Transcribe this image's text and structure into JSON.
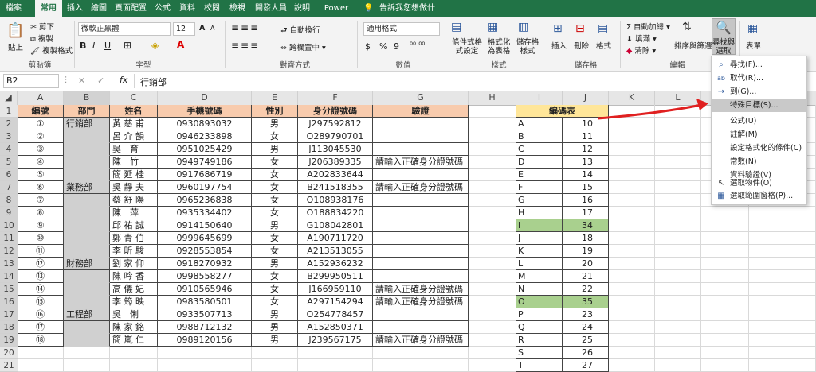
{
  "ribbon_tabs": [
    "檔案",
    "常用",
    "插入",
    "繪圖",
    "頁面配置",
    "公式",
    "資料",
    "校閱",
    "檢視",
    "開發人員",
    "說明",
    "Power Pivot",
    "告訴我您想做什麼"
  ],
  "clipboard": {
    "paste": "貼上",
    "cut": "剪下",
    "copy": "複製",
    "painter": "複製格式",
    "label": "剪貼簿"
  },
  "font": {
    "name": "微軟正黑體",
    "size": "12",
    "bold": "B",
    "italic": "I",
    "underline": "U",
    "label": "字型",
    "grow": "A",
    "shrink": "A"
  },
  "alignment": {
    "wrap": "自動換行",
    "merge": "跨欄置中",
    "label": "對齊方式"
  },
  "number": {
    "format": "通用格式",
    "label": "數值",
    "percent": "%",
    "comma": "9"
  },
  "styles": {
    "cond": "條件式格式設定",
    "table": "格式化為表格",
    "cell": "儲存格樣式",
    "label": "樣式"
  },
  "cells": {
    "insert": "插入",
    "delete": "刪除",
    "format": "格式",
    "label": "儲存格"
  },
  "editing": {
    "autosum": "自動加總",
    "fill": "填滿",
    "clear": "清除",
    "sort": "排序與篩選",
    "find": "尋找與選取",
    "label": "編輯"
  },
  "table_grp": {
    "btn": "表單"
  },
  "namebox": "B2",
  "formula": "行銷部",
  "fx": "fx",
  "columns": [
    "A",
    "B",
    "C",
    "D",
    "E",
    "F",
    "G",
    "H",
    "I",
    "J",
    "K",
    "L",
    "M"
  ],
  "row_numbers": [
    "1",
    "2",
    "3",
    "4",
    "5",
    "6",
    "7",
    "8",
    "9",
    "10",
    "11",
    "12",
    "13",
    "14",
    "15",
    "16",
    "17",
    "18",
    "19",
    "20",
    "21"
  ],
  "headers": [
    "編號",
    "部門",
    "姓名",
    "手機號碼",
    "性別",
    "身分證號碼",
    "驗證"
  ],
  "rows": [
    [
      "①",
      "行銷部",
      "黃 慈 甫",
      "0930893032",
      "男",
      "J297592812",
      ""
    ],
    [
      "②",
      "",
      "呂 介 韻",
      "0946233898",
      "女",
      "O289790701",
      ""
    ],
    [
      "③",
      "",
      "吳　育",
      "0951025429",
      "男",
      "J113045530",
      ""
    ],
    [
      "④",
      "",
      "陳　竹",
      "0949749186",
      "女",
      "J206389335",
      "請輸入正確身分證號碼"
    ],
    [
      "⑤",
      "",
      "簡 延 桂",
      "0917686719",
      "女",
      "A202833644",
      ""
    ],
    [
      "⑥",
      "業務部",
      "吳 靜 夫",
      "0960197754",
      "女",
      "B241518355",
      "請輸入正確身分證號碼"
    ],
    [
      "⑦",
      "",
      "蔡 舒 陽",
      "0965236838",
      "女",
      "O108938176",
      ""
    ],
    [
      "⑧",
      "",
      "陳　萍",
      "0935334402",
      "女",
      "O188834220",
      ""
    ],
    [
      "⑨",
      "",
      "邱 祐 誠",
      "0914150640",
      "男",
      "G108042801",
      ""
    ],
    [
      "⑩",
      "",
      "鄭 青 伯",
      "0999645699",
      "女",
      "A190711720",
      ""
    ],
    [
      "⑪",
      "",
      "李 昕 駿",
      "0928553854",
      "女",
      "A213513055",
      ""
    ],
    [
      "⑫",
      "財務部",
      "劉 家 仰",
      "0918270932",
      "男",
      "A152936232",
      ""
    ],
    [
      "⑬",
      "",
      "陳 吟 香",
      "0998558277",
      "女",
      "B299950511",
      ""
    ],
    [
      "⑭",
      "",
      "高 儀 妃",
      "0910565946",
      "女",
      "J166959110",
      "請輸入正確身分證號碼"
    ],
    [
      "⑮",
      "",
      "李 筠 映",
      "0983580501",
      "女",
      "A297154294",
      "請輸入正確身分證號碼"
    ],
    [
      "⑯",
      "工程部",
      "吳　俐",
      "0933507713",
      "男",
      "O254778457",
      ""
    ],
    [
      "⑰",
      "",
      "陳 家 銘",
      "0988712132",
      "男",
      "A152850371",
      ""
    ],
    [
      "⑱",
      "",
      "簡 嵐 仁",
      "0989120156",
      "男",
      "J239567175",
      "請輸入正確身分證號碼"
    ]
  ],
  "code_table": {
    "title": "編碼表",
    "rows": [
      [
        "A",
        "10"
      ],
      [
        "B",
        "11"
      ],
      [
        "C",
        "12"
      ],
      [
        "D",
        "13"
      ],
      [
        "E",
        "14"
      ],
      [
        "F",
        "15"
      ],
      [
        "G",
        "16"
      ],
      [
        "H",
        "17"
      ],
      [
        "I",
        "34"
      ],
      [
        "J",
        "18"
      ],
      [
        "K",
        "19"
      ],
      [
        "L",
        "20"
      ],
      [
        "M",
        "21"
      ],
      [
        "N",
        "22"
      ],
      [
        "O",
        "35"
      ],
      [
        "P",
        "23"
      ],
      [
        "Q",
        "24"
      ],
      [
        "R",
        "25"
      ],
      [
        "S",
        "26"
      ],
      [
        "T",
        "27"
      ]
    ]
  },
  "menu_items": [
    {
      "label": "尋找(F)...",
      "icon": "⌕"
    },
    {
      "label": "取代(R)...",
      "icon": "ab"
    },
    {
      "label": "到(G)...",
      "icon": "→"
    },
    {
      "label": "特殊目標(S)...",
      "icon": ""
    },
    {
      "label": "公式(U)",
      "icon": ""
    },
    {
      "label": "註解(M)",
      "icon": ""
    },
    {
      "label": "設定格式化的條件(C)",
      "icon": ""
    },
    {
      "label": "常數(N)",
      "icon": ""
    },
    {
      "label": "資料驗證(V)",
      "icon": ""
    },
    {
      "label": "選取物件(O)",
      "icon": "↖"
    },
    {
      "label": "選取範圍窗格(P)...",
      "icon": "▦"
    }
  ],
  "colors": {
    "excel_green": "#217346",
    "header_orange": "#f8cbad",
    "gray_merge": "#d0d0d0",
    "code_header": "#ffe699",
    "code_highlight": "#a9d08e",
    "arrow_red": "#e02020"
  }
}
